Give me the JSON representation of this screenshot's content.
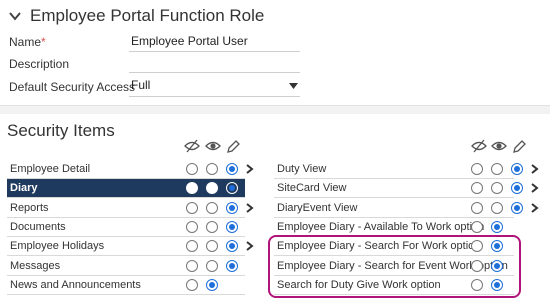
{
  "panel": {
    "title": "Employee Portal Function Role",
    "name_label": "Name",
    "required_mark": "*",
    "name_value": "Employee Portal User",
    "description_label": "Description",
    "description_value": "",
    "default_access_label": "Default Security Access",
    "default_access_value": "Full"
  },
  "security": {
    "title": "Security Items",
    "column_icons": [
      "hidden-eye-icon",
      "eye-icon",
      "pencil-icon"
    ],
    "left_items": [
      {
        "label": "Employee Detail",
        "selected_option": "edit",
        "has_arrow": true,
        "highlighted": false
      },
      {
        "label": "Diary",
        "selected_option": "edit",
        "has_arrow": true,
        "highlighted": true
      },
      {
        "label": "Reports",
        "selected_option": "edit",
        "has_arrow": true,
        "highlighted": false
      },
      {
        "label": "Documents",
        "selected_option": "edit",
        "has_arrow": false,
        "highlighted": false
      },
      {
        "label": "Employee Holidays",
        "selected_option": "edit",
        "has_arrow": true,
        "highlighted": false
      },
      {
        "label": "Messages",
        "selected_option": "edit",
        "has_arrow": false,
        "highlighted": false
      },
      {
        "label": "News and Announcements",
        "selected_option": "view",
        "has_arrow": false,
        "highlighted": false
      }
    ],
    "right_items": [
      {
        "label": "Duty View",
        "selected_option": "edit",
        "has_arrow": true
      },
      {
        "label": "SiteCard View",
        "selected_option": "edit",
        "has_arrow": true
      },
      {
        "label": "DiaryEvent View",
        "selected_option": "edit",
        "has_arrow": true
      },
      {
        "label": "Employee Diary - Available To Work option",
        "selected_option": "view",
        "has_arrow": false
      },
      {
        "label": "Employee Diary - Search For Work option",
        "selected_option": "view",
        "has_arrow": false
      },
      {
        "label": "Employee Diary - Search for Event Work option",
        "selected_option": "view",
        "has_arrow": false
      },
      {
        "label": "Search for Duty Give Work option",
        "selected_option": "view",
        "has_arrow": false
      }
    ]
  },
  "colors": {
    "accent": "#1e6fd9",
    "selected_row": "#1f3a5f",
    "highlight_border": "#b0147a",
    "required": "#d9534f"
  }
}
